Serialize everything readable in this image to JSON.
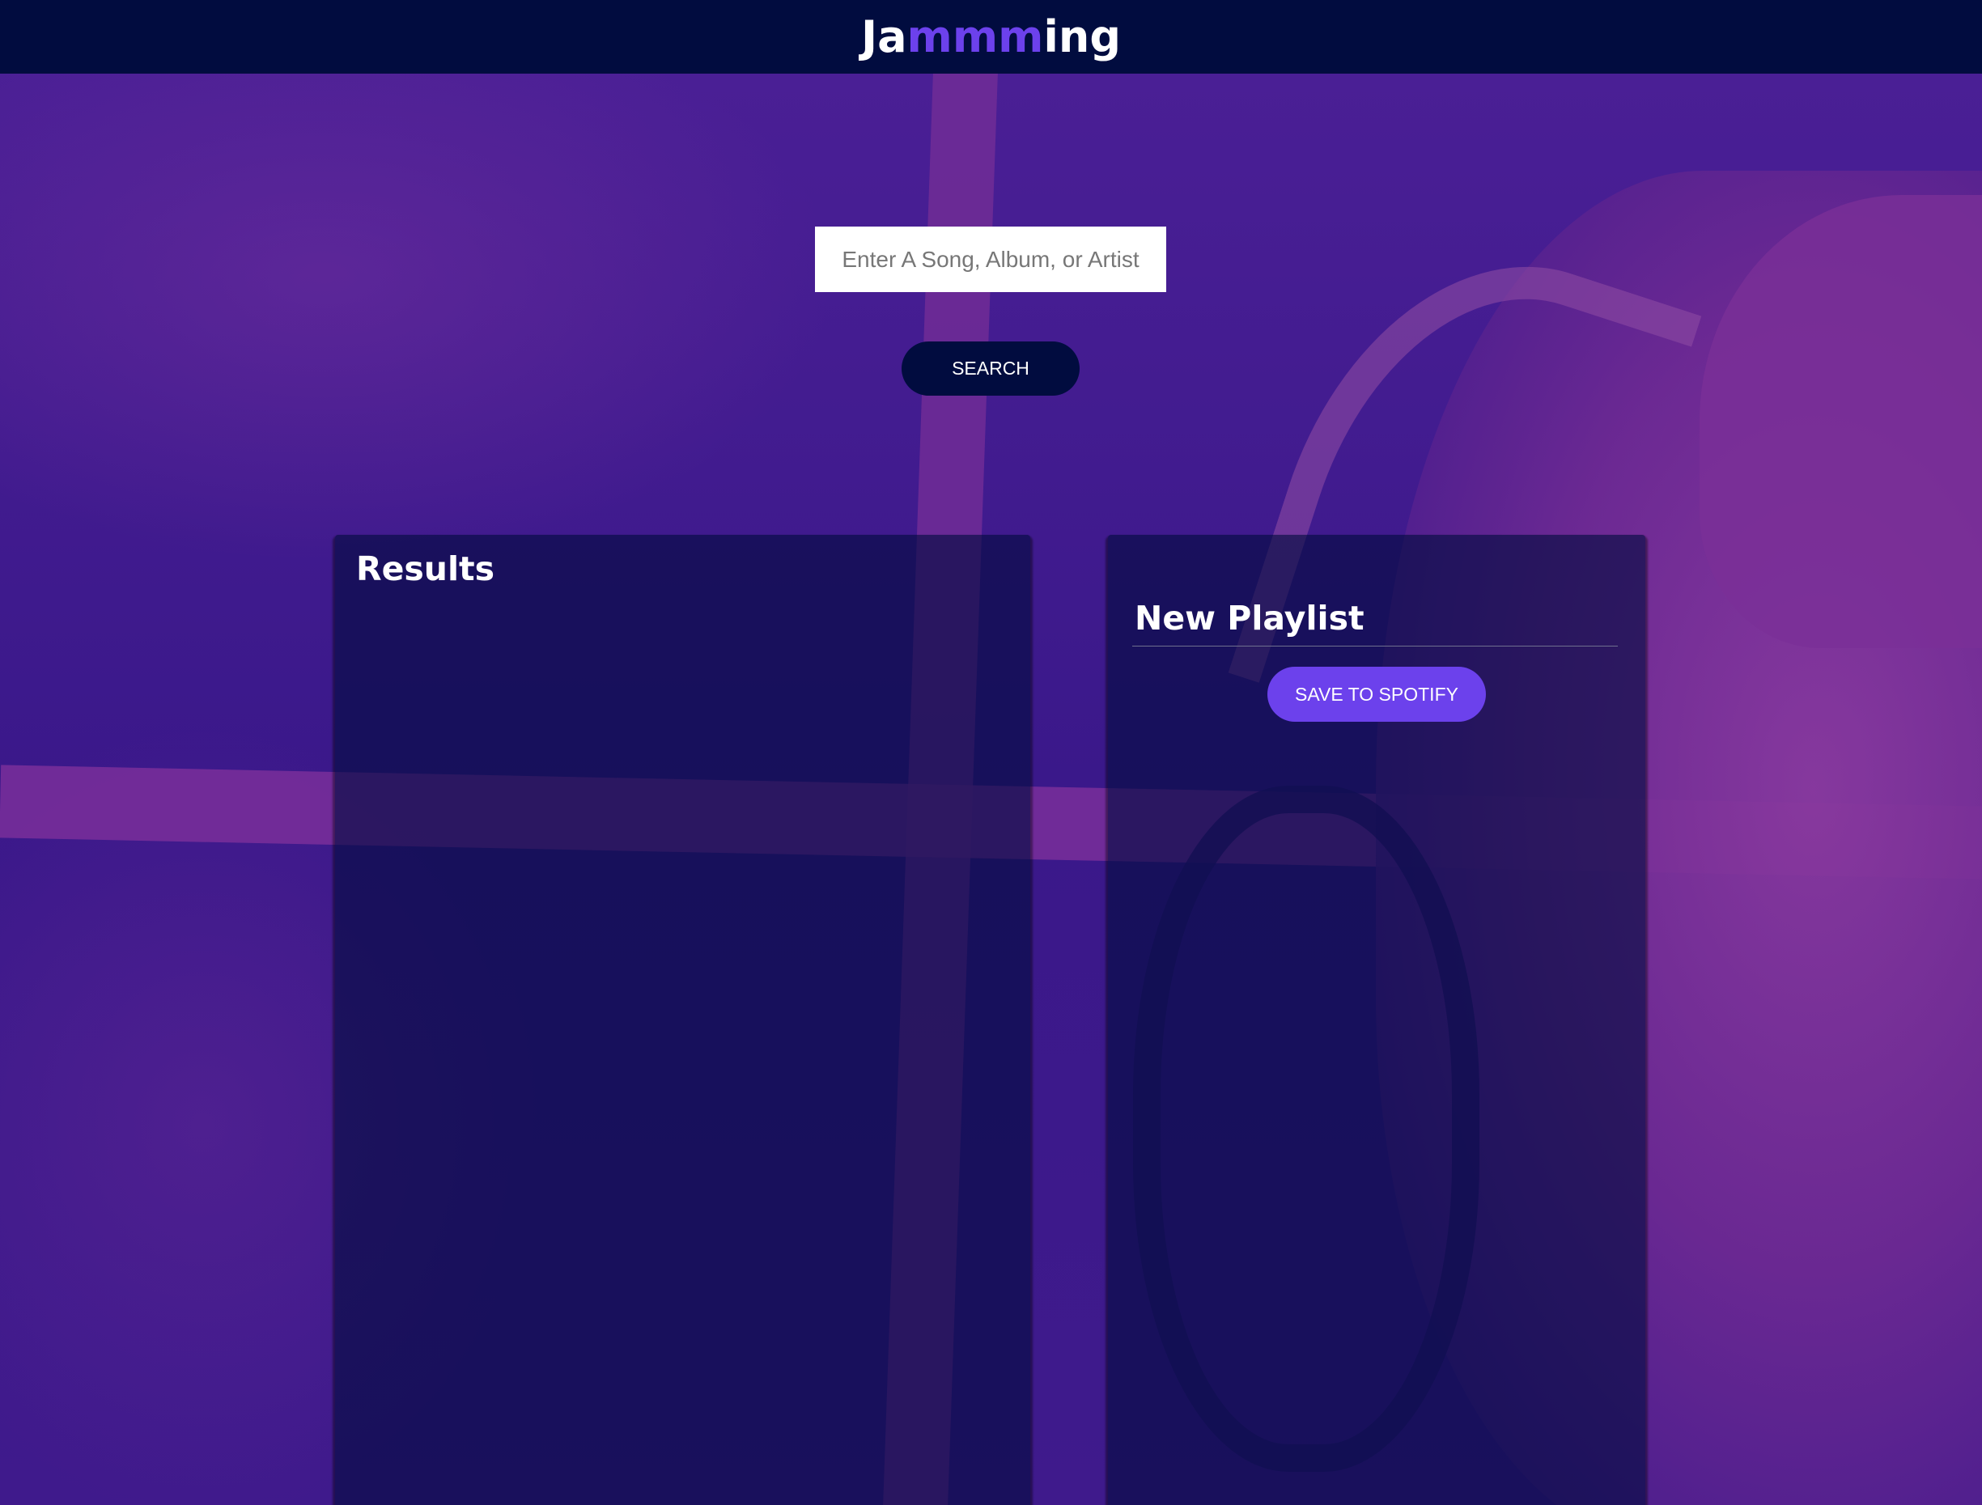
{
  "header": {
    "logo_prefix": "Ja",
    "logo_highlight": "mmm",
    "logo_suffix": "ing"
  },
  "search": {
    "placeholder": "Enter A Song, Album, or Artist",
    "value": "",
    "button_label": "SEARCH"
  },
  "results": {
    "title": "Results",
    "tracks": []
  },
  "playlist": {
    "title": "New Playlist",
    "save_label": "SAVE TO SPOTIFY",
    "tracks": []
  },
  "colors": {
    "header_bg": "#010c3f",
    "accent": "#6c41ec",
    "panel_bg": "#010c3f",
    "text": "#ffffff"
  }
}
